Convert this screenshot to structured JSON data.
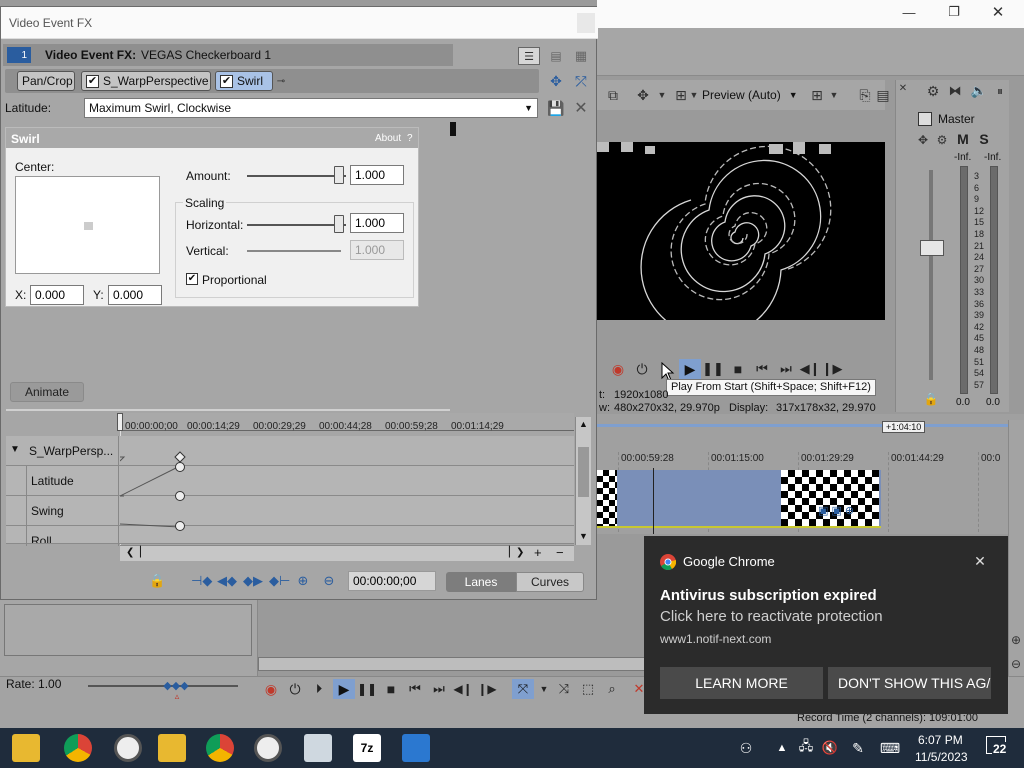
{
  "main_window": {
    "min_label": "—",
    "max_label": "❐",
    "close_label": "✕",
    "preview_quality": "Preview (Auto)",
    "project_info_label": "t:",
    "project_info_value": "1920x1080",
    "preview_info_label": "w:",
    "preview_info_value": "480x270x32, 29.970p",
    "display_label": "Display:",
    "display_value": "317x178x32, 29.970",
    "tooltip": "Play From Start (Shift+Space; Shift+F12)",
    "duration_marker": "+1:04:10",
    "timeline_ticks": [
      "00:00:59:28",
      "00:01:15:00",
      "00:01:29:29",
      "00:01:44:29",
      "00:0"
    ],
    "rate_label": "Rate: 1.00",
    "record_time": "Record Time (2 channels): 109:01:00"
  },
  "mixer": {
    "title": "Master",
    "m_label": "M",
    "s_label": "S",
    "inf_left": "-Inf.",
    "inf_right": "-Inf.",
    "scale": [
      "3",
      "6",
      "9",
      "12",
      "15",
      "18",
      "21",
      "24",
      "27",
      "30",
      "33",
      "36",
      "39",
      "42",
      "45",
      "48",
      "51",
      "54",
      "57"
    ],
    "bottom_left": "0.0",
    "bottom_right": "0.0"
  },
  "fx_window": {
    "title": "Video Event FX",
    "close_label": "✕",
    "chain_number": "1",
    "header_prefix": "Video Event FX:",
    "header_media": "VEGAS Checkerboard 1",
    "chain": [
      {
        "label": "Pan/Crop",
        "checked": false
      },
      {
        "label": "S_WarpPerspective",
        "checked": true
      },
      {
        "label": "Swirl",
        "checked": true
      }
    ],
    "preset_label": "Latitude:",
    "preset_value": "Maximum Swirl, Clockwise",
    "plugin": {
      "title": "Swirl",
      "about_label": "About",
      "help_label": "?",
      "center_label": "Center:",
      "x_label": "X:",
      "x_value": "0.000",
      "y_label": "Y:",
      "y_value": "0.000",
      "amount_label": "Amount:",
      "amount_value": "1.000",
      "amount_level": 0.93,
      "scaling_label": "Scaling",
      "horizontal_label": "Horizontal:",
      "horizontal_value": "1.000",
      "horizontal_level": 0.93,
      "vertical_label": "Vertical:",
      "vertical_value": "1.000",
      "proportional_label": "Proportional",
      "proportional_checked": true
    },
    "animate_label": "Animate",
    "keyframe_ticks": [
      "00:00:00;00",
      "00:00:14;29",
      "00:00:29;29",
      "00:00:44;28",
      "00:00:59;28",
      "00:01:14;29"
    ],
    "keyframe_tracks": [
      "S_WarpPersp...",
      "Latitude",
      "Swing",
      "Roll"
    ],
    "timecode": "00:00:00;00",
    "lanes_label": "Lanes",
    "curves_label": "Curves"
  },
  "notification": {
    "app": "Google Chrome",
    "title": "Antivirus subscription expired",
    "body": "Click here to reactivate protection",
    "site": "www1.notif-next.com",
    "primary": "LEARN MORE",
    "secondary": "DON'T SHOW THIS AG/",
    "close_label": "✕"
  },
  "taskbar": {
    "time": "6:07 PM",
    "date": "11/5/2023",
    "notification_count": "22",
    "apps": [
      "file-explorer",
      "chrome",
      "vegas",
      "file-explorer",
      "chrome",
      "vegas",
      "computer",
      "7zip",
      "vegas-pro"
    ]
  },
  "colors": {
    "accent_blue": "#2a5d9f",
    "notif_bg": "#2b2b2b",
    "taskbar_bg": "#1f2c3c",
    "event_blue": "#7a8fb8"
  }
}
